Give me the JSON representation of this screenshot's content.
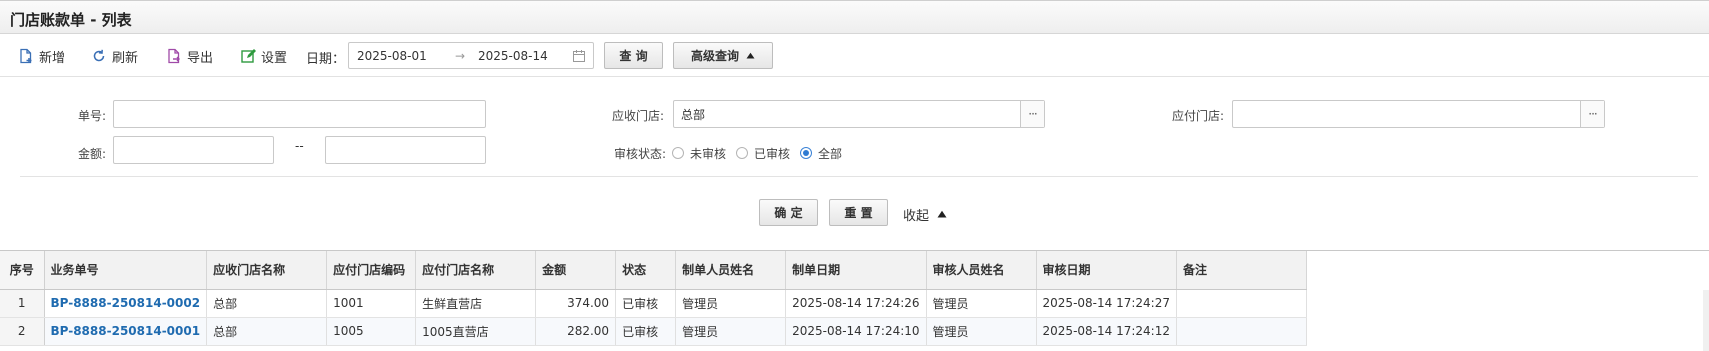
{
  "page": {
    "title": "门店账款单 - 列表"
  },
  "toolbar": {
    "add": "新增",
    "refresh": "刷新",
    "export": "导出",
    "settings": "设置",
    "date_label": "日期：",
    "date_from": "2025-08-01",
    "date_arrow": "→",
    "date_to": "2025-08-14",
    "query": "查 询",
    "advanced": "高级查询"
  },
  "filters": {
    "order_no_label": "单号:",
    "order_no_value": "",
    "amount_label": "金额:",
    "amount_from": "",
    "amount_sep": "--",
    "amount_to": "",
    "recv_store_label": "应收门店:",
    "recv_store_value": "总部",
    "pay_store_label": "应付门店:",
    "pay_store_value": "",
    "audit_label": "审核状态:",
    "audit_options": [
      "未审核",
      "已审核",
      "全部"
    ],
    "audit_selected": "全部",
    "ellipsis": "···",
    "confirm": "确 定",
    "reset": "重 置",
    "collapse": "收起"
  },
  "colors": {
    "link": "#1f6bb0",
    "accent": "#2f7bd2",
    "header_bg": "#f2f2f2"
  },
  "icons": {
    "add": "document-add-icon",
    "refresh": "refresh-icon",
    "export": "export-icon",
    "settings": "edit-settings-icon",
    "calendar": "calendar-icon",
    "collapse": "triangle-up-icon"
  },
  "table": {
    "columns": [
      "序号",
      "业务单号",
      "应收门店名称",
      "应付门店编码",
      "应付门店名称",
      "金额",
      "状态",
      "制单人员姓名",
      "制单日期",
      "审核人员姓名",
      "审核日期",
      "备注"
    ],
    "rows": [
      [
        "1",
        "BP-8888-250814-0002",
        "总部",
        "1001",
        "生鲜直营店",
        "374.00",
        "已审核",
        "管理员",
        "2025-08-14 17:24:26",
        "管理员",
        "2025-08-14 17:24:27",
        ""
      ],
      [
        "2",
        "BP-8888-250814-0001",
        "总部",
        "1005",
        "1005直营店",
        "282.00",
        "已审核",
        "管理员",
        "2025-08-14 17:24:10",
        "管理员",
        "2025-08-14 17:24:12",
        ""
      ]
    ]
  }
}
